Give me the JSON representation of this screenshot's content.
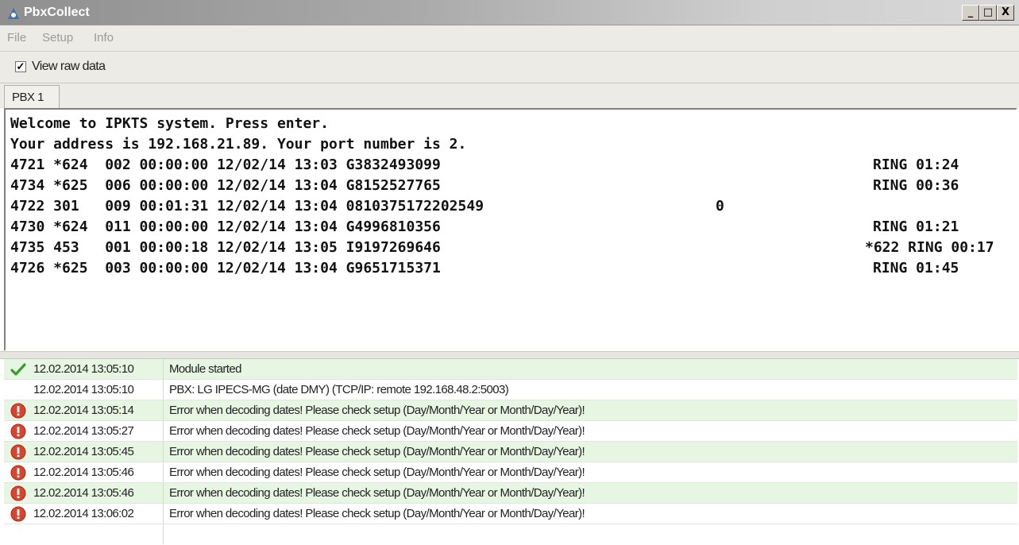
{
  "window": {
    "title": "PbxCollect",
    "minimize_glyph": "_",
    "maximize_glyph": "□",
    "close_glyph": "X"
  },
  "menu": {
    "items": [
      "File",
      "Setup",
      "Info"
    ]
  },
  "toolbar": {
    "view_raw_checked": true,
    "view_raw_label": "View raw data"
  },
  "tabs": [
    {
      "label": "PBX 1",
      "active": true
    }
  ],
  "raw_data": {
    "lines": [
      "Welcome to IPKTS system. Press enter.",
      "Your address is 192.168.21.89. Your port number is 2.",
      "4721 *624  002 00:00:00 12/02/14 13:03 G3832493099",
      "4734 *625  006 00:00:00 12/02/14 13:04 G8152527765",
      "4722 301   009 00:01:31 12/02/14 13:04 0810375172202549",
      "4730 *624  011 00:00:00 12/02/14 13:04 G4996810356",
      "4735 453   001 00:00:18 12/02/14 13:05 I9197269646",
      "4726 *625  003 00:00:00 12/02/14 13:04 G9651715371"
    ],
    "right_fields": [
      {
        "line": 2,
        "text": "RING 01:24"
      },
      {
        "line": 3,
        "text": "RING 00:36"
      },
      {
        "line": 4,
        "text": "0"
      },
      {
        "line": 5,
        "text": "RING 01:21"
      },
      {
        "line": 6,
        "text": "*622 RING 00:17"
      },
      {
        "line": 7,
        "text": "RING 01:45"
      }
    ]
  },
  "log": {
    "rows": [
      {
        "icon": "checkmark-icon",
        "time": "12.02.2014 13:05:10",
        "message": "Module started"
      },
      {
        "icon": "",
        "time": "12.02.2014 13:05:10",
        "message": "PBX: LG IPECS-MG (date DMY) (TCP/IP: remote 192.168.48.2:5003)"
      },
      {
        "icon": "error-icon",
        "time": "12.02.2014 13:05:14",
        "message": "Error when decoding dates! Please check setup (Day/Month/Year or Month/Day/Year)!"
      },
      {
        "icon": "error-icon",
        "time": "12.02.2014 13:05:27",
        "message": "Error when decoding dates! Please check setup (Day/Month/Year or Month/Day/Year)!"
      },
      {
        "icon": "error-icon",
        "time": "12.02.2014 13:05:45",
        "message": "Error when decoding dates! Please check setup (Day/Month/Year or Month/Day/Year)!"
      },
      {
        "icon": "error-icon",
        "time": "12.02.2014 13:05:46",
        "message": "Error when decoding dates! Please check setup (Day/Month/Year or Month/Day/Year)!"
      },
      {
        "icon": "error-icon",
        "time": "12.02.2014 13:05:46",
        "message": "Error when decoding dates! Please check setup (Day/Month/Year or Month/Day/Year)!"
      },
      {
        "icon": "error-icon",
        "time": "12.02.2014 13:06:02",
        "message": "Error when decoding dates! Please check setup (Day/Month/Year or Month/Day/Year)!"
      }
    ]
  },
  "colors": {
    "log_row_green": "#e7f6e2",
    "error_red": "#d9442f",
    "check_green": "#3a9a2a"
  }
}
